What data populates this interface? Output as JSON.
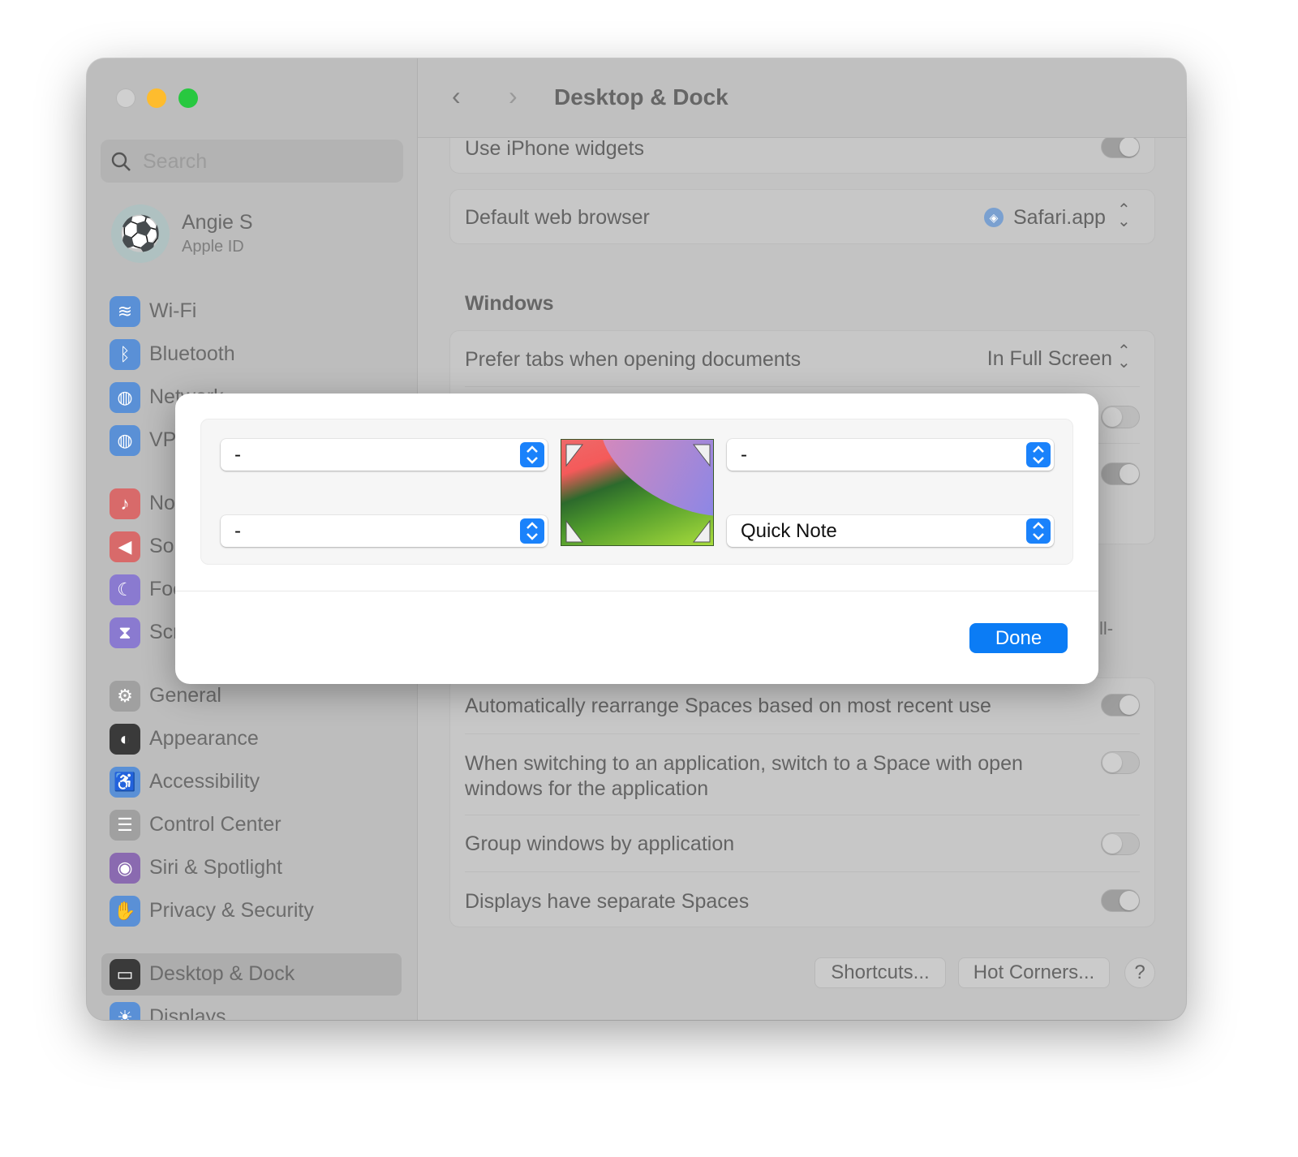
{
  "window": {
    "title": "Desktop & Dock",
    "traffic_lights": {
      "close": "#d0d0d0",
      "minimize": "#febc2e",
      "zoom": "#28c840"
    }
  },
  "sidebar": {
    "search_placeholder": "Search",
    "account": {
      "name": "Angie S",
      "subtitle": "Apple ID",
      "avatar_icon": "soccer-ball-icon"
    },
    "items": [
      {
        "label": "Wi-Fi",
        "icon": "wifi-icon",
        "color": "#5a90d6"
      },
      {
        "label": "Bluetooth",
        "icon": "bluetooth-icon",
        "color": "#5a90d6"
      },
      {
        "label": "Network",
        "icon": "globe-icon",
        "color": "#5a90d6"
      },
      {
        "label": "VPN",
        "icon": "vpn-globe-icon",
        "color": "#5a90d6"
      },
      {
        "label": "Notifications",
        "icon": "bell-icon",
        "color": "#d86a6a"
      },
      {
        "label": "Sound",
        "icon": "speaker-icon",
        "color": "#d86a6a"
      },
      {
        "label": "Focus",
        "icon": "moon-icon",
        "color": "#8a7ad0"
      },
      {
        "label": "Screen Time",
        "icon": "hourglass-icon",
        "color": "#8a7ad0"
      },
      {
        "label": "General",
        "icon": "gear-icon",
        "color": "#a0a0a0"
      },
      {
        "label": "Appearance",
        "icon": "appearance-icon",
        "color": "#3a3a3a"
      },
      {
        "label": "Accessibility",
        "icon": "accessibility-icon",
        "color": "#5a90d6"
      },
      {
        "label": "Control Center",
        "icon": "control-center-icon",
        "color": "#a0a0a0"
      },
      {
        "label": "Siri & Spotlight",
        "icon": "siri-icon",
        "color": "#8a6ab0"
      },
      {
        "label": "Privacy & Security",
        "icon": "hand-icon",
        "color": "#5a90d6"
      },
      {
        "label": "Desktop & Dock",
        "icon": "dock-icon",
        "color": "#3a3a3a",
        "selected": true
      },
      {
        "label": "Displays",
        "icon": "sun-icon",
        "color": "#5a90d6"
      }
    ]
  },
  "main": {
    "rows_top": [
      {
        "label": "Use iPhone widgets",
        "toggle": true
      },
      {
        "label": "Default web browser",
        "value": "Safari.app",
        "icon": "safari-icon"
      }
    ],
    "windows_heading": "Windows",
    "windows_rows": [
      {
        "label": "Prefer tabs when opening documents",
        "value": "In Full Screen"
      },
      {
        "toggle": false
      },
      {
        "toggle": true
      }
    ],
    "partial_text": "ll-",
    "spaces_rows": [
      {
        "label": "Automatically rearrange Spaces based on most recent use",
        "toggle": true
      },
      {
        "label": "When switching to an application, switch to a Space with open windows for the application",
        "toggle": false
      },
      {
        "label": "Group windows by application",
        "toggle": false
      },
      {
        "label": "Displays have separate Spaces",
        "toggle": true
      }
    ],
    "buttons": {
      "shortcuts": "Shortcuts...",
      "hot_corners": "Hot Corners...",
      "help": "?"
    }
  },
  "dialog": {
    "top_left": "-",
    "top_right": "-",
    "bottom_left": "-",
    "bottom_right": "Quick Note",
    "done": "Done",
    "accent": "#0b7cf5"
  }
}
